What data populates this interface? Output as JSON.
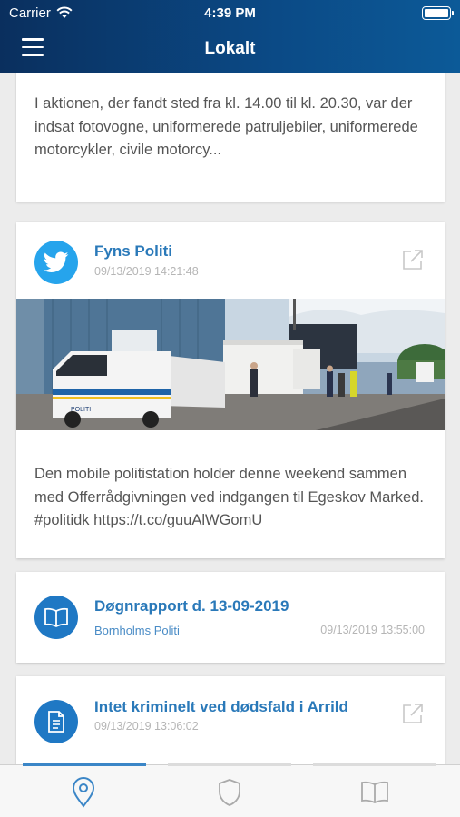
{
  "status": {
    "carrier": "Carrier",
    "time": "4:39 PM"
  },
  "header": {
    "title": "Lokalt"
  },
  "feed": {
    "card1": {
      "body": "I aktionen, der fandt sted fra kl. 14.00 til kl. 20.30, var der indsat fotovogne, uniformerede patruljebiler, uniformerede motorcykler, civile motorcy..."
    },
    "card2": {
      "title": "Fyns Politi",
      "timestamp": "09/13/2019 14:21:48",
      "van_label": "POLITI",
      "body": "Den mobile politistation holder denne weekend sammen med Offerrådgivningen ved indgangen til Egeskov Marked. #politidk https://t.co/guuAlWGomU"
    },
    "card3": {
      "title": "Døgnrapport d. 13-09-2019",
      "source": "Bornholms Politi",
      "timestamp": "09/13/2019 13:55:00"
    },
    "card4": {
      "title": "Intet kriminelt ved dødsfald i Arrild",
      "timestamp": "09/13/2019 13:06:02"
    }
  },
  "tabbar": {
    "items": [
      {
        "icon": "location-pin-icon",
        "active": true
      },
      {
        "icon": "shield-icon",
        "active": false
      },
      {
        "icon": "book-icon",
        "active": false
      }
    ]
  },
  "colors": {
    "accent": "#2a79b9",
    "header": "#0b4a86",
    "twitter": "#26a4ec"
  }
}
